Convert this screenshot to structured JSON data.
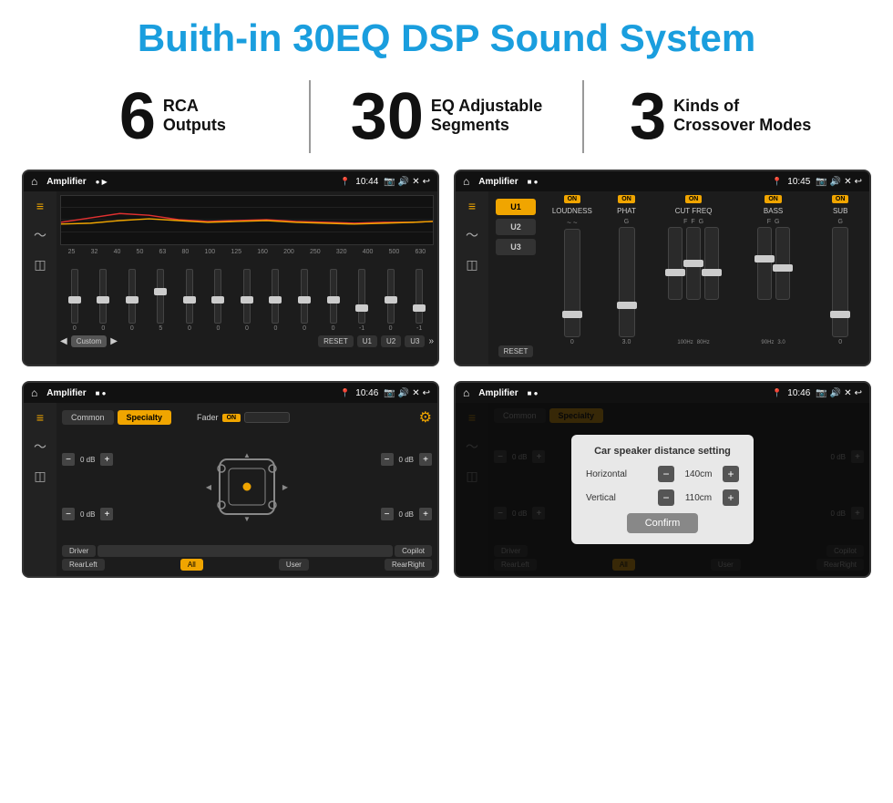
{
  "header": {
    "title": "Buith-in 30EQ DSP Sound System"
  },
  "stats": [
    {
      "number": "6",
      "line1": "RCA",
      "line2": "Outputs"
    },
    {
      "number": "30",
      "line1": "EQ Adjustable",
      "line2": "Segments"
    },
    {
      "number": "3",
      "line1": "Kinds of",
      "line2": "Crossover Modes"
    }
  ],
  "screen1": {
    "statusbar": {
      "title": "Amplifier",
      "dots": "● ▶",
      "time": "10:44"
    },
    "eq_labels": [
      "25",
      "32",
      "40",
      "50",
      "63",
      "80",
      "100",
      "125",
      "160",
      "200",
      "250",
      "320",
      "400",
      "500",
      "630"
    ],
    "eq_values": [
      "0",
      "0",
      "0",
      "5",
      "0",
      "0",
      "0",
      "0",
      "0",
      "0",
      "-1",
      "0",
      "-1"
    ],
    "preset_label": "Custom",
    "buttons": [
      "RESET",
      "U1",
      "U2",
      "U3"
    ]
  },
  "screen2": {
    "statusbar": {
      "title": "Amplifier",
      "dots": "■ ●",
      "time": "10:45"
    },
    "presets": [
      "U1",
      "U2",
      "U3"
    ],
    "controls": [
      "LOUDNESS",
      "PHAT",
      "CUT FREQ",
      "BASS",
      "SUB"
    ],
    "reset_label": "RESET"
  },
  "screen3": {
    "statusbar": {
      "title": "Amplifier",
      "dots": "■ ●",
      "time": "10:46"
    },
    "tabs": [
      "Common",
      "Specialty"
    ],
    "fader_label": "Fader",
    "fader_on": "ON",
    "speakers": {
      "front_left_db": "0 dB",
      "front_right_db": "0 dB",
      "rear_left_db": "0 dB",
      "rear_right_db": "0 dB"
    },
    "buttons": [
      "Driver",
      "Copilot",
      "RearLeft",
      "All",
      "User",
      "RearRight"
    ]
  },
  "screen4": {
    "statusbar": {
      "title": "Amplifier",
      "dots": "■ ●",
      "time": "10:46"
    },
    "tabs": [
      "Common",
      "Specialty"
    ],
    "dialog": {
      "title": "Car speaker distance setting",
      "horizontal_label": "Horizontal",
      "horizontal_value": "140cm",
      "vertical_label": "Vertical",
      "vertical_value": "110cm",
      "confirm_label": "Confirm"
    },
    "buttons": [
      "Driver",
      "Copilot",
      "RearLeft",
      "All",
      "User",
      "RearRight"
    ],
    "right_db1": "0 dB",
    "right_db2": "0 dB"
  }
}
